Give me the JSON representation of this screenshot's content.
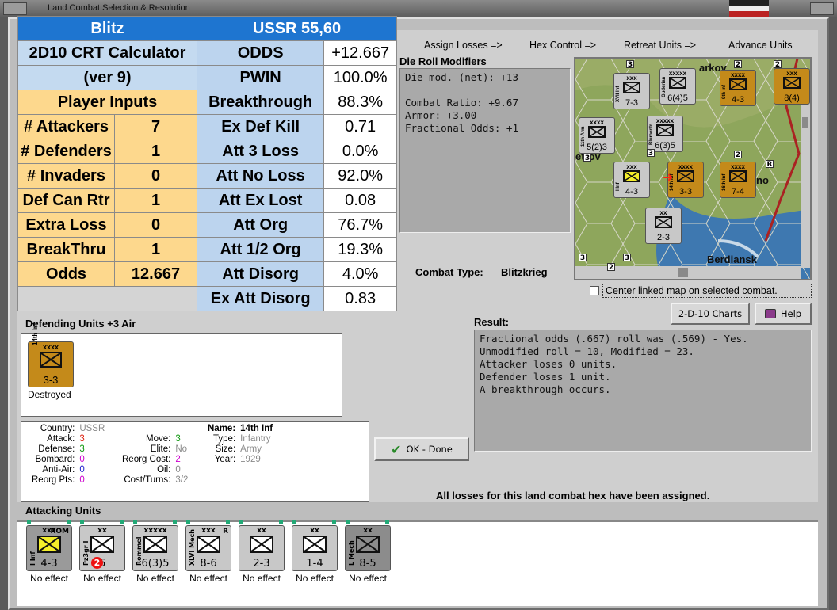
{
  "window": {
    "title": "Land Combat Selection & Resolution"
  },
  "colors": {
    "accent": "#1e75d0",
    "yellow": "#fdd88d",
    "light_blue": "#c4daf0"
  },
  "calc": {
    "rows": [
      {
        "l": "Blitz",
        "lv": "",
        "r": "USSR 55,60",
        "rv": ""
      },
      {
        "l": "2D10 CRT Calculator",
        "lv": "",
        "r": "ODDS",
        "rv": "+12.667"
      },
      {
        "l": "(ver 9)",
        "lv": "",
        "r": "PWIN",
        "rv": "100.0%"
      },
      {
        "l": "Player Inputs",
        "lv": "",
        "r": "Breakthrough",
        "rv": "88.3%"
      },
      {
        "l": "# Attackers",
        "lv": "7",
        "r": "Ex Def Kill",
        "rv": "0.71"
      },
      {
        "l": "# Defenders",
        "lv": "1",
        "r": "Att 3 Loss",
        "rv": "0.0%"
      },
      {
        "l": "# Invaders",
        "lv": "0",
        "r": "Att No Loss",
        "rv": "92.0%"
      },
      {
        "l": "Def Can Rtr",
        "lv": "1",
        "r": "Att Ex Lost",
        "rv": "0.08"
      },
      {
        "l": "Extra Loss",
        "lv": "0",
        "r": "Att Org",
        "rv": "76.7%"
      },
      {
        "l": "BreakThru",
        "lv": "1",
        "r": "Att 1/2 Org",
        "rv": "19.3%"
      },
      {
        "l": "Odds",
        "lv": "12.667",
        "r": "Att Disorg",
        "rv": "4.0%"
      },
      {
        "l": "",
        "lv": "",
        "r": "Ex Att Disorg",
        "rv": "0.83"
      }
    ]
  },
  "tabs": {
    "t1": "Assign Losses =>",
    "t2": "Hex Control =>",
    "t3": "Retreat Units =>",
    "t4": "Advance Units"
  },
  "modifiers": {
    "title": "Die Roll Modifiers",
    "lines": [
      "Die mod. (net): +13",
      "",
      "Combat Ratio: +9.67",
      "Armor: +3.00",
      "Fractional Odds: +1"
    ]
  },
  "map": {
    "labels": {
      "l1": "etrov",
      "l2": "no",
      "l3": "Berdiansk",
      "l4": "arkov"
    },
    "units": [
      {
        "size": "xxx",
        "name": "XVII Inf",
        "val": "7-3",
        "color": "#c8c8c8"
      },
      {
        "size": "xxxxx",
        "name": "Guderian",
        "val": "6(4)5",
        "color": "#c8c8c8"
      },
      {
        "size": "xxxx",
        "name": "9th Inf",
        "val": "4-3",
        "color": "#c48a1a"
      },
      {
        "size": "xxx",
        "name": "",
        "val": "8(4)",
        "color": "#c48a1a"
      },
      {
        "size": "xxxx",
        "name": "11th Arm",
        "val": "5(2)3",
        "color": "#c8c8c8"
      },
      {
        "size": "xxxxx",
        "name": "Blumentr",
        "val": "6(3)5",
        "color": "#c8c8c8"
      },
      {
        "size": "xxx",
        "name": "I Inf",
        "val": "4-3",
        "color": "#c8c8c8"
      },
      {
        "size": "xxxx",
        "name": "14th Inf",
        "val": "3-3",
        "color": "#c48a1a"
      },
      {
        "size": "xxxx",
        "name": "16th Inf",
        "val": "7-4",
        "color": "#c48a1a"
      },
      {
        "size": "xx",
        "name": "",
        "val": "2-3",
        "color": "#c8c8c8"
      }
    ],
    "numbers": {
      "n1": "3",
      "n2": "2",
      "n3": "3",
      "n4": "3",
      "n5": "2",
      "n6": "2",
      "n7": "3",
      "n8": "2",
      "n9": "3",
      "n10": "R"
    }
  },
  "combat_type": {
    "label": "Combat Type:",
    "value": "Blitzkrieg"
  },
  "center_linked": {
    "label": "Center linked map on selected combat."
  },
  "buttons": {
    "charts": "2-D-10 Charts",
    "help": "Help",
    "ok": "OK - Done"
  },
  "result": {
    "title": "Result:",
    "lines": [
      "Fractional odds (.667) roll was (.569)  - Yes.",
      "Unmodified roll = 10, Modified = 23.",
      "Attacker loses 0 units.",
      "Defender loses 1 unit.",
      "A breakthrough occurs."
    ]
  },
  "defending": {
    "title": "Defending Units +3 Air",
    "unit": {
      "size": "xxxx",
      "name": "14th Inf",
      "val": "3-3",
      "status": "Destroyed"
    }
  },
  "info": {
    "country_k": "Country:",
    "country_v": "USSR",
    "attack_k": "Attack:",
    "attack_v": "3",
    "defense_k": "Defense:",
    "defense_v": "3",
    "bombard_k": "Bombard:",
    "bombard_v": "0",
    "antiair_k": "Anti-Air:",
    "antiair_v": "0",
    "reorg_k": "Reorg Pts:",
    "reorg_v": "0",
    "move_k": "Move:",
    "move_v": "3",
    "elite_k": "Elite:",
    "elite_v": "No",
    "reorgcost_k": "Reorg Cost:",
    "reorgcost_v": "2",
    "oil_k": "Oil:",
    "oil_v": "0",
    "costturns_k": "Cost/Turns:",
    "costturns_v": "3/2",
    "name_k": "Name:",
    "name_v": "14th Inf",
    "type_k": "Type:",
    "type_v": "Infantry",
    "size_k": "Size:",
    "size_v": "Army",
    "year_k": "Year:",
    "year_v": "1929"
  },
  "status_msg": "All losses for this land combat hex have been assigned.",
  "attacking": {
    "title": "Attacking Units",
    "units": [
      {
        "size": "xxx",
        "name": "I Inf",
        "side2": "ROM",
        "val": "4-3",
        "effect": "No effect",
        "color": "#9a9a9a",
        "box": "#f4ee2a"
      },
      {
        "size": "xx",
        "name": "Pz3gr I",
        "side2": "",
        "val": "6",
        "badge": "2",
        "effect": "No effect",
        "color": "#c8c8c8",
        "box": "#ffffff"
      },
      {
        "size": "xxxxx",
        "name": "Rommel",
        "side2": "",
        "val": "6(3)5",
        "effect": "No effect",
        "color": "#c8c8c8",
        "box": "#ffffff"
      },
      {
        "size": "xxx",
        "name": "XLVI Mech",
        "side2": "R",
        "val": "8-6",
        "effect": "No effect",
        "color": "#c8c8c8",
        "box": "#ffffff"
      },
      {
        "size": "xx",
        "name": "",
        "side2": "",
        "val": "2-3",
        "effect": "No effect",
        "color": "#c8c8c8",
        "box": "#ffffff"
      },
      {
        "size": "xx",
        "name": "",
        "side2": "",
        "val": "1-4",
        "effect": "No effect",
        "color": "#c8c8c8",
        "box": "#ffffff"
      },
      {
        "size": "xx",
        "name": "L Mech",
        "side2": "",
        "val": "8-5",
        "effect": "No effect",
        "color": "#8c8c8c",
        "box": "#8c8c8c"
      }
    ]
  }
}
